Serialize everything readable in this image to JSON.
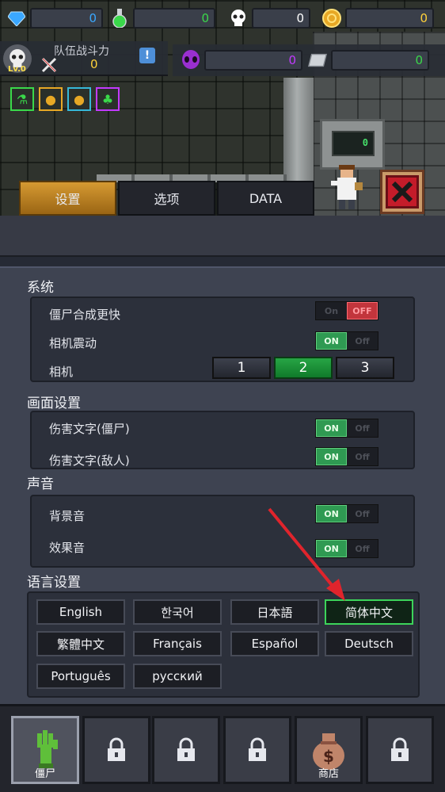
{
  "resources": {
    "gem": {
      "icon": "gem-icon",
      "value": "0",
      "color": "#3aa8ff"
    },
    "potion": {
      "icon": "potion-icon",
      "value": "0",
      "color": "#3ad84a"
    },
    "skull": {
      "icon": "skull-icon",
      "value": "0",
      "color": "#ffffff"
    },
    "coin": {
      "icon": "coin-icon",
      "value": "0",
      "color": "#ffd23a"
    },
    "alien": {
      "icon": "alien-icon",
      "value": "0",
      "color": "#c23aff"
    },
    "bar": {
      "icon": "silver-bar-icon",
      "value": "0",
      "color": "#3ad84a"
    }
  },
  "team": {
    "level": "Lv.0",
    "title": "队伍战斗力",
    "power": "0",
    "info": "!"
  },
  "machine_readout": "0",
  "tabs": [
    {
      "label": "设置",
      "active": true
    },
    {
      "label": "选项",
      "active": false
    },
    {
      "label": "DATA",
      "active": false
    }
  ],
  "sections": {
    "system": {
      "title": "系统",
      "rows": [
        {
          "label": "僵尸合成更快",
          "on": "On",
          "off": "OFF",
          "state": "off"
        },
        {
          "label": "相机震动",
          "on": "ON",
          "off": "Off",
          "state": "on"
        },
        {
          "label": "相机",
          "options": [
            "1",
            "2",
            "3"
          ],
          "selected": "2"
        }
      ]
    },
    "display": {
      "title": "画面设置",
      "rows": [
        {
          "label": "伤害文字(僵尸)",
          "on": "ON",
          "off": "Off",
          "state": "on"
        },
        {
          "label": "伤害文字(敌人)",
          "on": "ON",
          "off": "Off",
          "state": "on"
        }
      ]
    },
    "sound": {
      "title": "声音",
      "rows": [
        {
          "label": "背景音",
          "on": "ON",
          "off": "Off",
          "state": "on"
        },
        {
          "label": "效果音",
          "on": "ON",
          "off": "Off",
          "state": "on"
        }
      ]
    },
    "language": {
      "title": "语言设置",
      "options": [
        "English",
        "한국어",
        "日本語",
        "简体中文",
        "繁體中文",
        "Français",
        "Español",
        "Deutsch",
        "Português",
        "русский"
      ],
      "selected": "简体中文"
    }
  },
  "bottom_nav": [
    {
      "label": "僵尸",
      "icon": "zombie-hand-icon",
      "active": true
    },
    {
      "label": "",
      "icon": "lock-icon",
      "active": false
    },
    {
      "label": "",
      "icon": "lock-icon",
      "active": false
    },
    {
      "label": "",
      "icon": "lock-icon",
      "active": false
    },
    {
      "label": "商店",
      "icon": "money-bag-icon",
      "active": false
    },
    {
      "label": "",
      "icon": "lock-icon",
      "active": false
    }
  ]
}
